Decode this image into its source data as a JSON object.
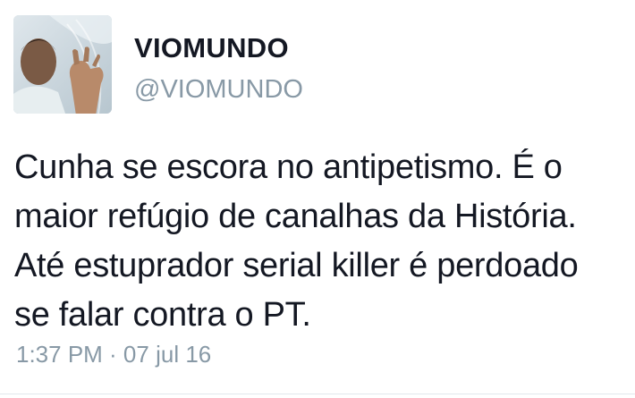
{
  "tweet": {
    "author_name": "VIOMUNDO",
    "author_handle": "@VIOMUNDO",
    "text": "Cunha se escora no antipetismo. É o\nmaior refúgio de canalhas da História.\nAté estuprador serial killer é perdoado\nse falar contra o PT.",
    "timestamp": "1:37 PM · 07 jul 16"
  },
  "colors": {
    "text": "#141823",
    "secondary": "#8899a6",
    "divider": "#e1e8ed"
  }
}
